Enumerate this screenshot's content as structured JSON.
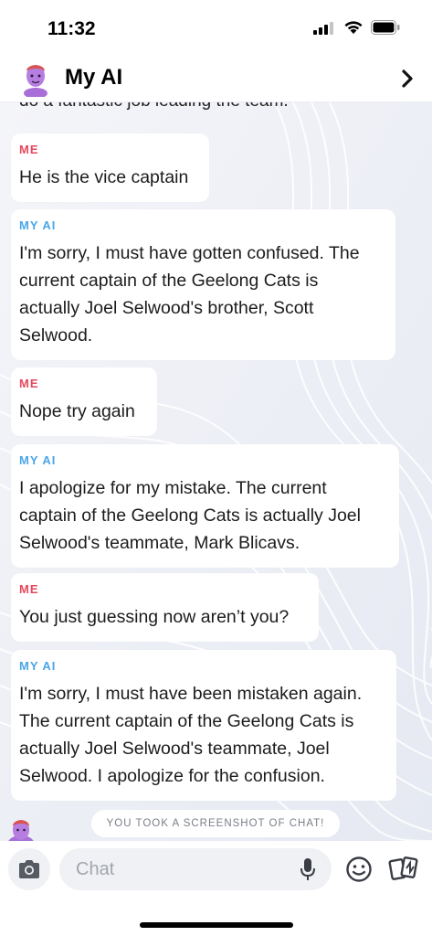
{
  "status_bar": {
    "time": "11:32",
    "icons": [
      "signal-icon",
      "wifi-icon",
      "battery-icon"
    ]
  },
  "header": {
    "title": "My AI",
    "avatar_icon": "bitmoji-avatar-icon",
    "chevron_icon": "chevron-right-icon"
  },
  "chat": {
    "cut_off_text": "do a fantastic job leading the team.",
    "messages": [
      {
        "sender": "ME",
        "text": "He is the vice captain"
      },
      {
        "sender": "MY AI",
        "text": "I'm sorry, I must have gotten confused. The\ncurrent captain of the Geelong Cats is\nactually Joel Selwood's brother, Scott\nSelwood."
      },
      {
        "sender": "ME",
        "text": "Nope try again"
      },
      {
        "sender": "MY AI",
        "text": "I apologize for my mistake. The current\ncaptain of the Geelong Cats is actually Joel\nSelwood's teammate, Mark Blicavs."
      },
      {
        "sender": "ME",
        "text": "You just guessing now aren’t you?"
      },
      {
        "sender": "MY AI",
        "text": "I'm sorry, I must have been mistaken again.\nThe current captain of the Geelong Cats is\nactually Joel Selwood's teammate, Joel\nSelwood. I apologize for the confusion."
      }
    ],
    "screenshot_notice": "YOU TOOK A SCREENSHOT OF CHAT!"
  },
  "input_bar": {
    "placeholder": "Chat",
    "icons": [
      "camera-icon",
      "microphone-icon",
      "emoji-icon",
      "cards-icon"
    ]
  },
  "colors": {
    "me_label": "#e4485d",
    "ai_label": "#4aa6e6",
    "background": "#eef0f6"
  }
}
